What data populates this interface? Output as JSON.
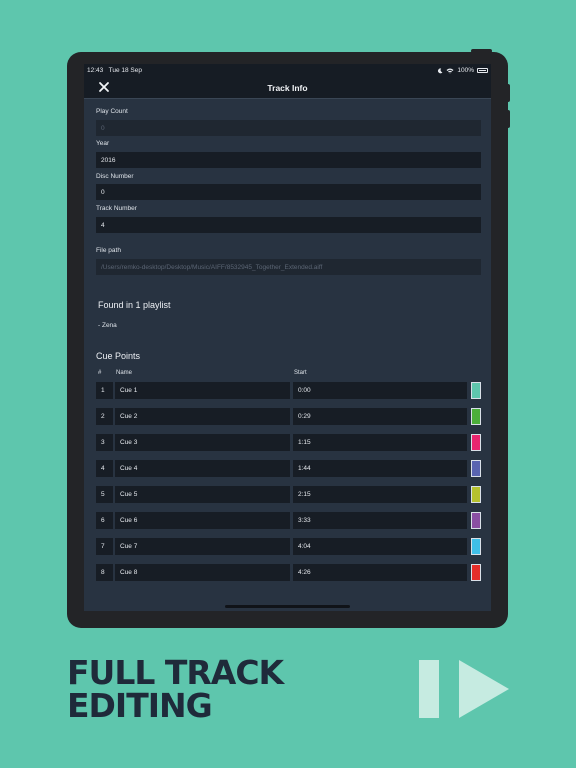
{
  "status_bar": {
    "time": "12:43",
    "date": "Tue 18 Sep",
    "battery": "100%"
  },
  "nav": {
    "title": "Track Info"
  },
  "fields": [
    {
      "label": "Play Count",
      "value": "0",
      "disabled": true
    },
    {
      "label": "Year",
      "value": "2016",
      "disabled": false
    },
    {
      "label": "Disc Number",
      "value": "0",
      "disabled": false
    },
    {
      "label": "Track Number",
      "value": "4",
      "disabled": false
    },
    {
      "label": "File path",
      "value": "/Users/remko-desktop/Desktop/Music/AIFF/8532945_Together_Extended.aiff",
      "disabled": true
    }
  ],
  "playlists": {
    "heading": "Found in 1 playlist",
    "items": [
      "- Zena"
    ]
  },
  "cue_points": {
    "heading": "Cue Points",
    "columns": {
      "num": "#",
      "name": "Name",
      "start": "Start"
    },
    "rows": [
      {
        "num": "1",
        "name": "Cue 1",
        "start": "0:00",
        "color": "#5ec6ad"
      },
      {
        "num": "2",
        "name": "Cue 2",
        "start": "0:29",
        "color": "#4caf3a"
      },
      {
        "num": "3",
        "name": "Cue 3",
        "start": "1:15",
        "color": "#e9256f"
      },
      {
        "num": "4",
        "name": "Cue 4",
        "start": "1:44",
        "color": "#5964b0"
      },
      {
        "num": "5",
        "name": "Cue 5",
        "start": "2:15",
        "color": "#b6c12f"
      },
      {
        "num": "6",
        "name": "Cue 6",
        "start": "3:33",
        "color": "#8a4fa3"
      },
      {
        "num": "7",
        "name": "Cue 7",
        "start": "4:04",
        "color": "#3fbfe8"
      },
      {
        "num": "8",
        "name": "Cue 8",
        "start": "4:26",
        "color": "#e52d2a"
      }
    ]
  },
  "promo": {
    "line1": "FULL TRACK",
    "line2": "EDITING"
  },
  "colors": {
    "background": "#5ec6ad",
    "promo_text": "#1f2a3a",
    "logo": "#c6ebe1"
  }
}
